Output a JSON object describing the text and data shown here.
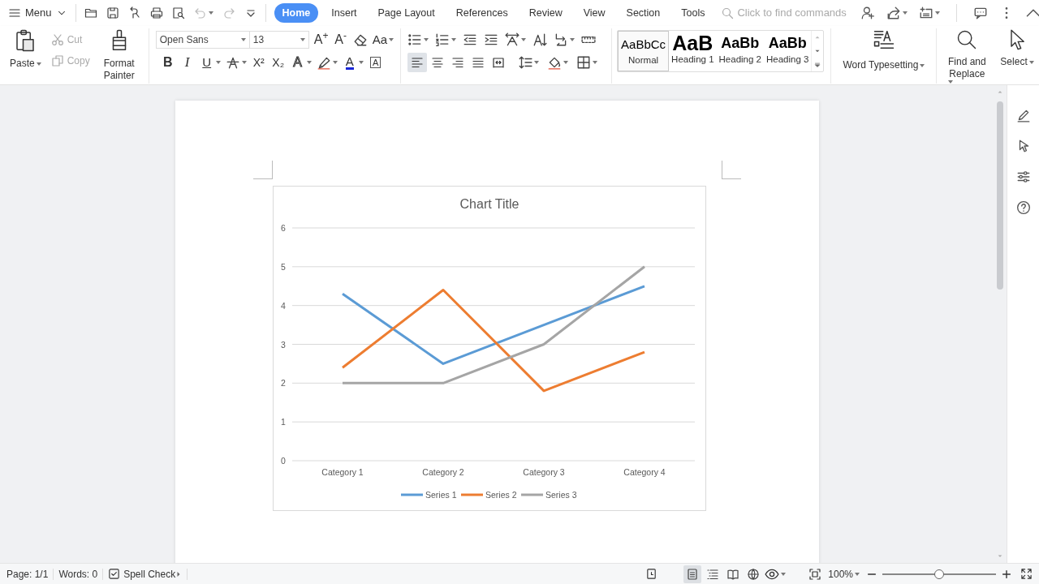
{
  "menu": {
    "label": "Menu"
  },
  "quick_access": [
    {
      "disabled": false
    },
    {
      "disabled": false
    },
    {
      "disabled": false
    },
    {
      "disabled": false
    },
    {
      "disabled": false
    },
    {
      "disabled": true,
      "caret": true
    },
    {
      "disabled": true
    },
    {
      "disabled": false
    }
  ],
  "tabs": [
    {
      "label": "Home",
      "selected": true
    },
    {
      "label": "Insert",
      "selected": false
    },
    {
      "label": "Page Layout",
      "selected": false
    },
    {
      "label": "References",
      "selected": false
    },
    {
      "label": "Review",
      "selected": false
    },
    {
      "label": "View",
      "selected": false
    },
    {
      "label": "Section",
      "selected": false
    },
    {
      "label": "Tools",
      "selected": false
    }
  ],
  "search": {
    "placeholder": "Click to find commands"
  },
  "clipboard": {
    "paste": "Paste",
    "cut": {
      "label": "Cut",
      "disabled": true
    },
    "copy": {
      "label": "Copy",
      "disabled": true
    },
    "format_painter": "Format Painter"
  },
  "font": {
    "name": "Open Sans",
    "size": "13",
    "tools_top": [
      {
        "kind": "grow",
        "label": "A$^{+}$"
      },
      {
        "kind": "shrink",
        "label": "A$^{-}$"
      },
      {
        "kind": "clear"
      },
      {
        "kind": "case",
        "label": "Aa",
        "caret": true
      }
    ],
    "tools_bottom": [
      {
        "kind": "bold",
        "label": "B"
      },
      {
        "kind": "italic",
        "label": "I"
      },
      {
        "kind": "underline",
        "label": "U",
        "caret": true
      },
      {
        "kind": "strike",
        "caret": true
      },
      {
        "kind": "super",
        "label": "X²"
      },
      {
        "kind": "sub",
        "label": "X₂"
      },
      {
        "kind": "effect",
        "label": "A",
        "caret": true
      },
      {
        "kind": "highlight",
        "caret": true
      },
      {
        "kind": "color",
        "label": "A",
        "caret": true
      },
      {
        "kind": "border",
        "label": "A"
      }
    ]
  },
  "paragraph": {
    "tools_top": [
      {
        "kind": "bullets",
        "caret": true
      },
      {
        "kind": "numbering",
        "caret": true
      },
      {
        "kind": "outdent"
      },
      {
        "kind": "indent"
      },
      {
        "kind": "asian",
        "caret": true
      },
      {
        "kind": "sort"
      },
      {
        "kind": "direction",
        "caret": true
      },
      {
        "kind": "ruler"
      }
    ],
    "alignment": [
      {
        "kind": "left",
        "selected": true
      },
      {
        "kind": "center",
        "selected": false
      },
      {
        "kind": "right",
        "selected": false
      },
      {
        "kind": "justify",
        "selected": false
      },
      {
        "kind": "distribute",
        "selected": false
      }
    ],
    "tools_bottom": [
      {
        "kind": "spacing",
        "caret": true
      },
      {
        "kind": "shading",
        "caret": true
      },
      {
        "kind": "borders",
        "caret": true
      }
    ]
  },
  "styles": [
    {
      "kind": "normal",
      "preview": "AaBbCc",
      "label": "Normal",
      "selected": true
    },
    {
      "kind": "h1",
      "preview": "AaB",
      "label": "Heading 1",
      "selected": false
    },
    {
      "kind": "h2",
      "preview": "AaBb",
      "label": "Heading 2",
      "selected": false
    },
    {
      "kind": "h3",
      "preview": "AaBb",
      "label": "Heading 3",
      "selected": false
    }
  ],
  "word_typesetting": {
    "label": "Word Typesetting"
  },
  "find_replace": {
    "label": "Find and Replace"
  },
  "select": {
    "label": "Select"
  },
  "document": {
    "chart": {
      "chart_data": {
        "type": "line",
        "title": "Chart Title",
        "categories": [
          "Category 1",
          "Category 2",
          "Category 3",
          "Category 4"
        ],
        "series": [
          {
            "name": "Series 1",
            "color": "#5b9bd5",
            "values": [
              4.3,
              2.5,
              3.5,
              4.5
            ]
          },
          {
            "name": "Series 2",
            "color": "#ed7d31",
            "values": [
              2.4,
              4.4,
              1.8,
              2.8
            ]
          },
          {
            "name": "Series 3",
            "color": "#a5a5a5",
            "values": [
              2,
              2,
              3,
              5
            ]
          }
        ],
        "ylim": [
          0,
          6
        ],
        "yticks": [
          0,
          1,
          2,
          3,
          4,
          5,
          6
        ],
        "grid": true,
        "legend": true
      }
    }
  },
  "status_bar": {
    "page": "Page: 1/1",
    "words": "Words: 0",
    "spell_check": "Spell Check",
    "views": [
      {
        "kind": "print",
        "selected": true
      },
      {
        "kind": "outline",
        "selected": false
      },
      {
        "kind": "reading",
        "selected": false
      },
      {
        "kind": "web",
        "selected": false
      }
    ],
    "zoom": "100%",
    "zoom_slider": {
      "level": 0.5
    }
  }
}
